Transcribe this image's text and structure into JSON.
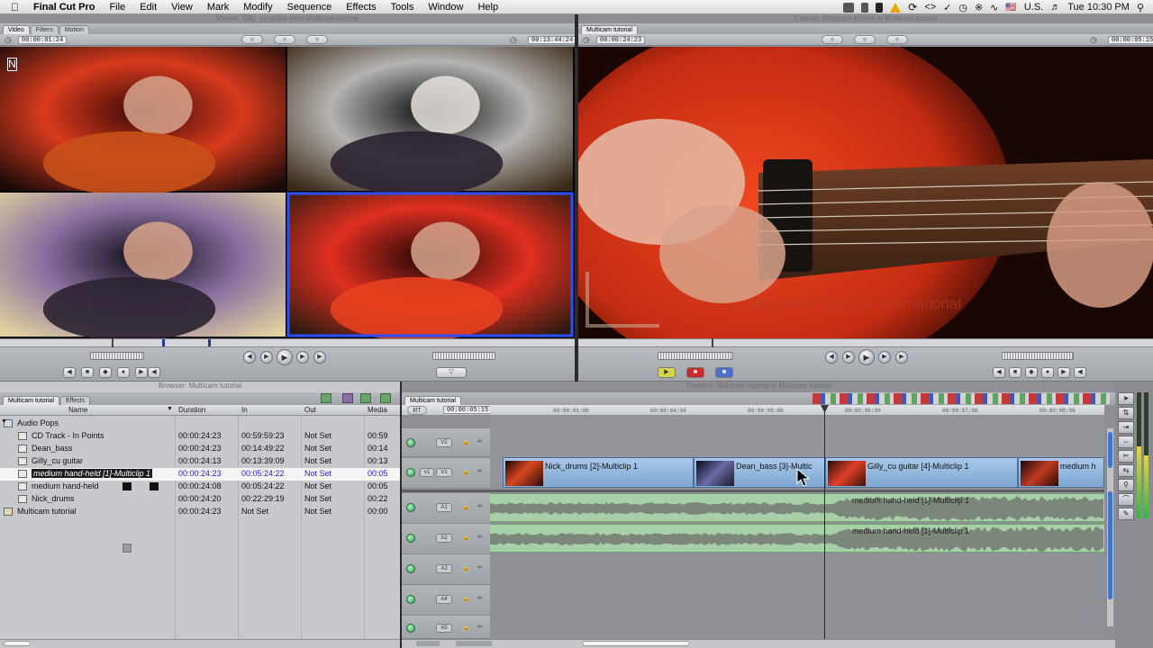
{
  "menubar": {
    "apple": "",
    "app": "Final Cut Pro",
    "items": [
      "File",
      "Edit",
      "View",
      "Mark",
      "Modify",
      "Sequence",
      "Effects",
      "Tools",
      "Window",
      "Help"
    ],
    "locale": "U.S.",
    "clock": "Tue 10:30 PM"
  },
  "viewer": {
    "title": "Viewer: Gilly_cu guitar from Multicam tutorial",
    "tabs": [
      "Video",
      "Filters",
      "Motion"
    ],
    "duration": "00:00:01:24",
    "timecode": "00:13:44:24",
    "angles": [
      {
        "label": "Nick_drums",
        "colors": [
          "#3a0808",
          "#d83a1c",
          "#1a0a0a"
        ]
      },
      {
        "label": "Dean_bass",
        "colors": [
          "#0c0c10",
          "#b5b3b1",
          "#3a2a18"
        ]
      },
      {
        "label": "Gilly_cu guitar",
        "colors": [
          "#0c0a14",
          "#8a6fa0",
          "#e0d0a0"
        ]
      },
      {
        "label": "medium hand-held",
        "colors": [
          "#1a0606",
          "#e02f20",
          "#2a1a10"
        ]
      }
    ]
  },
  "canvas": {
    "title": "Canvas: Multicam tutorial in Multicam tutorial",
    "tab": "Multicam tutorial",
    "duration": "00:00:24:23",
    "timecode": "00:00:05:15",
    "watermark": "Weynand Training International"
  },
  "browser": {
    "title": "Browser: Multicam tutorial",
    "tabs": [
      "Multicam tutorial",
      "Effects"
    ],
    "columns": [
      "Name",
      "Duration",
      "In",
      "Out",
      "Media"
    ],
    "rows": [
      {
        "name": "Audio Pops",
        "duration": "",
        "in": "",
        "out": "",
        "media": "",
        "type": "bin"
      },
      {
        "name": "CD Track - In Points",
        "duration": "00:00:24:23",
        "in": "00:59:59:23",
        "out": "Not Set",
        "media": "00:59",
        "type": "clip"
      },
      {
        "name": "Dean_bass",
        "duration": "00:00:24:23",
        "in": "00:14:49:22",
        "out": "Not Set",
        "media": "00:14",
        "type": "clip"
      },
      {
        "name": "Gilly_cu guitar",
        "duration": "00:00:24:13",
        "in": "00:13:39:09",
        "out": "Not Set",
        "media": "00:13",
        "type": "clip"
      },
      {
        "name": "medium hand-held [1]-Multiclip 1",
        "duration": "00:00:24:23",
        "in": "00:05:24:22",
        "out": "Not Set",
        "media": "00:05",
        "type": "multiclip"
      },
      {
        "name": "medium hand-held",
        "duration": "00:00:24:08",
        "in": "00:05:24:22",
        "out": "Not Set",
        "media": "00:05",
        "type": "clip"
      },
      {
        "name": "Nick_drums",
        "duration": "00:00:24:20",
        "in": "00:22:29:19",
        "out": "Not Set",
        "media": "00:22",
        "type": "clip"
      },
      {
        "name": "Multicam tutorial",
        "duration": "00:00:24:23",
        "in": "Not Set",
        "out": "Not Set",
        "media": "00:00",
        "type": "sequence"
      }
    ]
  },
  "timeline": {
    "title": "Timeline: Multicam tutorial in Multicam tutorial",
    "tab": "Multicam tutorial",
    "timecode": "00:00:05:15",
    "ruler": [
      "00:00:03:00",
      "00:00:04:00",
      "00:00:05:00",
      "00:00:06:00",
      "00:00:07:00",
      "00:00:08:00"
    ],
    "tracks": {
      "video": [
        {
          "src": "v1",
          "dest": "V1"
        },
        {
          "dest": "V2"
        }
      ],
      "audio": [
        "A1",
        "A2",
        "A3",
        "A4",
        "A5"
      ]
    },
    "video_clips": [
      {
        "name": "Nick_drums [2]-Multiclip 1"
      },
      {
        "name": "Dean_bass [3]-Multic"
      },
      {
        "name": "Gilly_cu guitar [4]-Multiclip 1"
      },
      {
        "name": "medium h"
      }
    ],
    "audio_clips": [
      {
        "name": "medium hand-held [1]-Multiclip 1"
      },
      {
        "name": "medium hand-held [1]-Multiclip 1"
      }
    ]
  }
}
